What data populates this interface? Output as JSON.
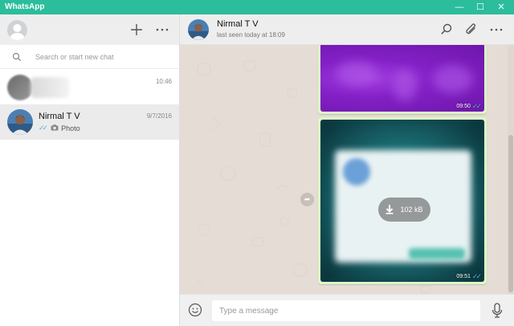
{
  "window": {
    "title": "WhatsApp",
    "minimize_glyph": "—",
    "maximize_glyph": "☐",
    "close_glyph": "✕"
  },
  "sidebar": {
    "new_chat_icon": "plus-icon",
    "menu_icon": "more-horizontal-icon",
    "search": {
      "placeholder": "Search or start new chat",
      "value": ""
    },
    "chats": [
      {
        "name": "",
        "time": "10:46",
        "preview": ""
      },
      {
        "name": "Nirmal T V",
        "time": "9/7/2016",
        "preview": "Photo",
        "status": "read"
      }
    ]
  },
  "conversation": {
    "contact_name": "Nirmal T V",
    "last_seen": "last seen today at 18:09",
    "messages": [
      {
        "type": "image",
        "time": "09:50",
        "status": "read"
      },
      {
        "type": "image",
        "time": "09:51",
        "status": "read",
        "download_size": "102 kB"
      }
    ],
    "composer": {
      "placeholder": "Type a message",
      "value": ""
    }
  },
  "colors": {
    "titlebar": "#2bbd9c",
    "read_tick": "#4fb6ec",
    "chat_background": "#e5ddd5",
    "outgoing_bubble": "#dcf8c6"
  }
}
